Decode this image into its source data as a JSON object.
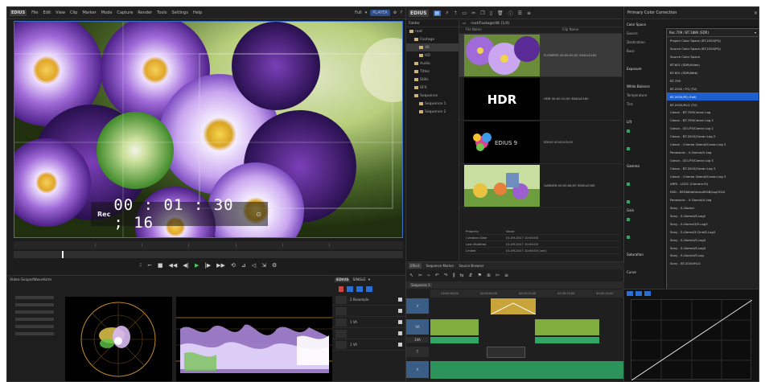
{
  "menubar": {
    "logo": "EDIUS",
    "items": [
      "File",
      "Edit",
      "View",
      "Clip",
      "Marker",
      "Mode",
      "Capture",
      "Render",
      "Tools",
      "Settings",
      "Help"
    ],
    "fullscreen": "Full",
    "mode": "PLAYER"
  },
  "viewer": {
    "timecode_label": "Rec",
    "timecode": "00 : 01 : 30 ; 16"
  },
  "scopes": {
    "title": "Video Scope/Waveform"
  },
  "bin": {
    "logo": "EDIUS",
    "tree_header": "Folder",
    "tree": [
      {
        "label": "root",
        "depth": 0,
        "selected": false
      },
      {
        "label": "Footage",
        "depth": 1,
        "selected": false
      },
      {
        "label": "4K",
        "depth": 2,
        "selected": true
      },
      {
        "label": "HD",
        "depth": 2,
        "selected": false
      },
      {
        "label": "Audio",
        "depth": 1,
        "selected": false
      },
      {
        "label": "Titles",
        "depth": 1,
        "selected": false
      },
      {
        "label": "Stills",
        "depth": 1,
        "selected": false
      },
      {
        "label": "SFX",
        "depth": 1,
        "selected": false
      },
      {
        "label": "Sequence",
        "depth": 1,
        "selected": false
      },
      {
        "label": "Sequence 1",
        "depth": 2,
        "selected": false
      },
      {
        "label": "Sequence 2",
        "depth": 2,
        "selected": false
      }
    ],
    "path": "root/Footage/4K (1/4)",
    "columns": [
      "File Name",
      "Clip Name"
    ],
    "clips": [
      {
        "thumb": "flowers",
        "meta": "FLOWERS   00:00:05;00 3840x2160",
        "selected": true
      },
      {
        "thumb": "hdr",
        "meta": "HDR      00:00:10;00 3840x2160",
        "selected": false
      },
      {
        "thumb": "edius",
        "meta": "EDIUS    00:00:05;00",
        "selected": false
      },
      {
        "thumb": "garden",
        "meta": "GARDEN   00:00:08;00 3840x2160",
        "selected": false
      }
    ],
    "properties": [
      {
        "k": "Property",
        "v": "Value"
      },
      {
        "k": "Creation Date",
        "v": "01.09.2017 10:00:00"
      },
      {
        "k": "Last Modified",
        "v": "01.09.2017 10:00:00"
      },
      {
        "k": "Linked",
        "v": "01.09.2017 10:00:00 (sec)"
      }
    ]
  },
  "timeline": {
    "tabs": [
      "Effect",
      "Sequence Marker",
      "Source Browser"
    ],
    "logo": "EDIUS",
    "mode": "SINGLE",
    "sequence": "Sequence 1",
    "ruler": [
      "00:00:00;00",
      "00:00:05;00",
      "00:00:10;00",
      "00:00:15;00",
      "00:00:20;00"
    ],
    "tracks": [
      "V",
      "VA",
      "1VA",
      "T",
      "A"
    ],
    "left_rows": [
      {
        "label": "2 Resample",
        "k": "V"
      },
      {
        "label": "",
        "k": "1"
      },
      {
        "label": "1 VA",
        "k": "VA"
      },
      {
        "label": "",
        "k": "2"
      },
      {
        "label": "1 VA",
        "k": "A"
      }
    ]
  },
  "rightpanel": {
    "title": "Primary Color Correction",
    "close": "×",
    "left_rows": [
      {
        "t": "Color Space",
        "sec": true
      },
      {
        "t": "Source",
        "sec": false
      },
      {
        "t": "Destination",
        "sec": false
      },
      {
        "t": "Base",
        "sec": false
      },
      {
        "t": "",
        "sec": false
      },
      {
        "t": "Exposure",
        "sec": true
      },
      {
        "t": "",
        "sec": false
      },
      {
        "t": "White Balance",
        "sec": true
      },
      {
        "t": "Temperature",
        "sec": false
      },
      {
        "t": "Tint",
        "sec": false
      },
      {
        "t": "",
        "sec": false
      },
      {
        "t": "Lift",
        "sec": true
      },
      {
        "t": "",
        "sec": false
      },
      {
        "t": "",
        "sec": false
      },
      {
        "t": "",
        "sec": false
      },
      {
        "t": "",
        "sec": false
      },
      {
        "t": "Gamma",
        "sec": true
      },
      {
        "t": "",
        "sec": false
      },
      {
        "t": "",
        "sec": false
      },
      {
        "t": "",
        "sec": false
      },
      {
        "t": "",
        "sec": false
      },
      {
        "t": "Gain",
        "sec": true
      },
      {
        "t": "",
        "sec": false
      },
      {
        "t": "",
        "sec": false
      },
      {
        "t": "",
        "sec": false
      },
      {
        "t": "",
        "sec": false
      },
      {
        "t": "Saturation",
        "sec": true
      },
      {
        "t": "",
        "sec": false
      },
      {
        "t": "Curve",
        "sec": true
      }
    ],
    "dropdown_selected": "Rec.709 / BT.1886 (SDR)",
    "dropdown_options": [
      "Project Color Space (BT.2020/PQ)",
      "Source Color Space (BT.2020/PQ)",
      "Source Color Space",
      "BT.601 (SDR/Video)",
      "BT.601 (SDR/Web)",
      "BT.709",
      "BT.2020 / PQ (TV)",
      "BT.2020/PQ (Full)",
      "BT.2020/HLG (TV)",
      "Canon - BT.709/Canon Log",
      "Canon - BT.709/Canon Log 2",
      "Canon - DCI-P3/Canon Log 2",
      "Canon - BT.2020/Canon Log 2",
      "Canon - Cinema Gamut/Canon Log 2",
      "Panasonic - V-Gamut/V-Log",
      "Canon - DCI-P3/Canon Log 3",
      "Canon - BT.2020/Canon Log 3",
      "Canon - Cinema Gamut/Canon Log 3",
      "ARRI - LOGC (Camera EI)",
      "RED - REDWideGamutRGB/Log3G10",
      "Panasonic - V-Gamut/V-Log",
      "Sony - S-Gamut",
      "Sony - S-Gamut/S-Log2",
      "Sony - S-Gamut3/S-Log3",
      "Sony - S-Gamut3.Cine/S-Log3",
      "Sony - S-Gamut/S-Log3",
      "Sony - S-Gamut/S-Log3",
      "Sony - S-Gamut/S-Log",
      "Sony - BT.2020/HLG"
    ],
    "highlighted_index": 7,
    "status": "1HDR_709TO_HLG/HLG_Coverage (70%, 100%)"
  },
  "colors": {
    "accent": "#2b6fd4",
    "highlight": "#1e5fd0",
    "play": "#44cc55",
    "video_clip": "#7fae3f",
    "audio_clip": "#2fa866",
    "transition": "#c8a43a"
  }
}
